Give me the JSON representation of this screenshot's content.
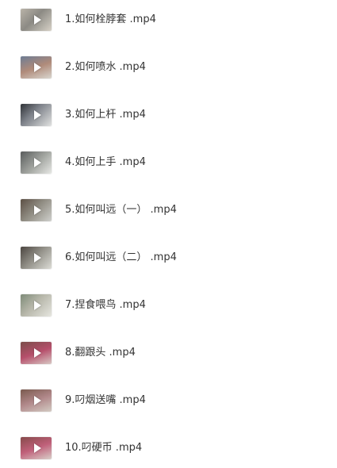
{
  "files": [
    {
      "name": "1.如何栓脖套 .mp4",
      "thumb_icon": "video-thumbnail-icon"
    },
    {
      "name": "2.如何喷水 .mp4",
      "thumb_icon": "video-thumbnail-icon"
    },
    {
      "name": "3.如何上杆 .mp4",
      "thumb_icon": "video-thumbnail-icon"
    },
    {
      "name": "4.如何上手 .mp4",
      "thumb_icon": "video-thumbnail-icon"
    },
    {
      "name": "5.如何叫远（一） .mp4",
      "thumb_icon": "video-thumbnail-icon"
    },
    {
      "name": "6.如何叫远（二） .mp4",
      "thumb_icon": "video-thumbnail-icon"
    },
    {
      "name": "7.捏食喂鸟 .mp4",
      "thumb_icon": "video-thumbnail-icon"
    },
    {
      "name": "8.翻跟头 .mp4",
      "thumb_icon": "video-thumbnail-icon"
    },
    {
      "name": "9.叼烟送嘴 .mp4",
      "thumb_icon": "video-thumbnail-icon"
    },
    {
      "name": "10.叼硬币 .mp4",
      "thumb_icon": "video-thumbnail-icon"
    }
  ],
  "colors": {
    "text": "#333333",
    "background": "#ffffff",
    "play_icon": "#ffffff"
  }
}
